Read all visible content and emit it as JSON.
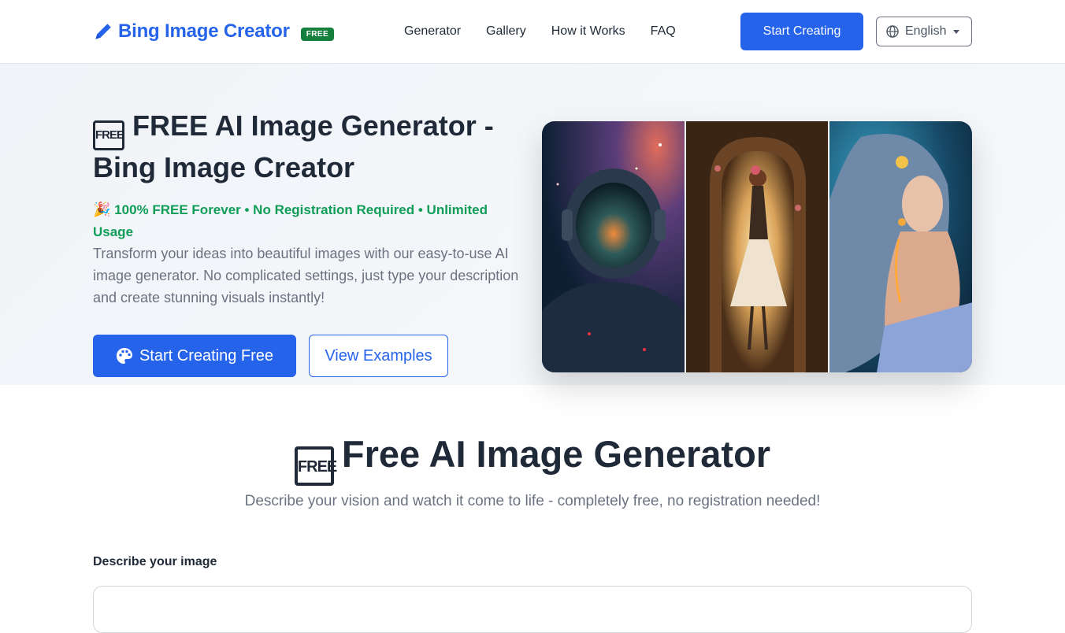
{
  "header": {
    "brand_name": "Bing Image Creator",
    "brand_badge": "FREE",
    "nav": [
      "Generator",
      "Gallery",
      "How it Works",
      "FAQ"
    ],
    "cta_label": "Start Creating",
    "language": "English"
  },
  "hero": {
    "title_emoji": "FREE",
    "title": "FREE AI Image Generator - Bing Image Creator",
    "subtitle": "100% FREE Forever • No Registration Required • Unlimited Usage",
    "description": "Transform your ideas into beautiful images with our easy-to-use AI image generator. No complicated settings, just type your description and create stunning visuals instantly!",
    "primary_button": "Start Creating Free",
    "secondary_button": "View Examples",
    "images": [
      "astronaut-image",
      "woman-doorway-image",
      "glowing-woman-image"
    ]
  },
  "generator": {
    "title_emoji": "FREE",
    "title": "Free AI Image Generator",
    "subtitle": "Describe your vision and watch it come to life - completely free, no registration needed!",
    "prompt_label": "Describe your image",
    "prompt_value": ""
  },
  "colors": {
    "accent": "#2563eb",
    "success": "#0f9d58",
    "badge": "#15803d"
  }
}
